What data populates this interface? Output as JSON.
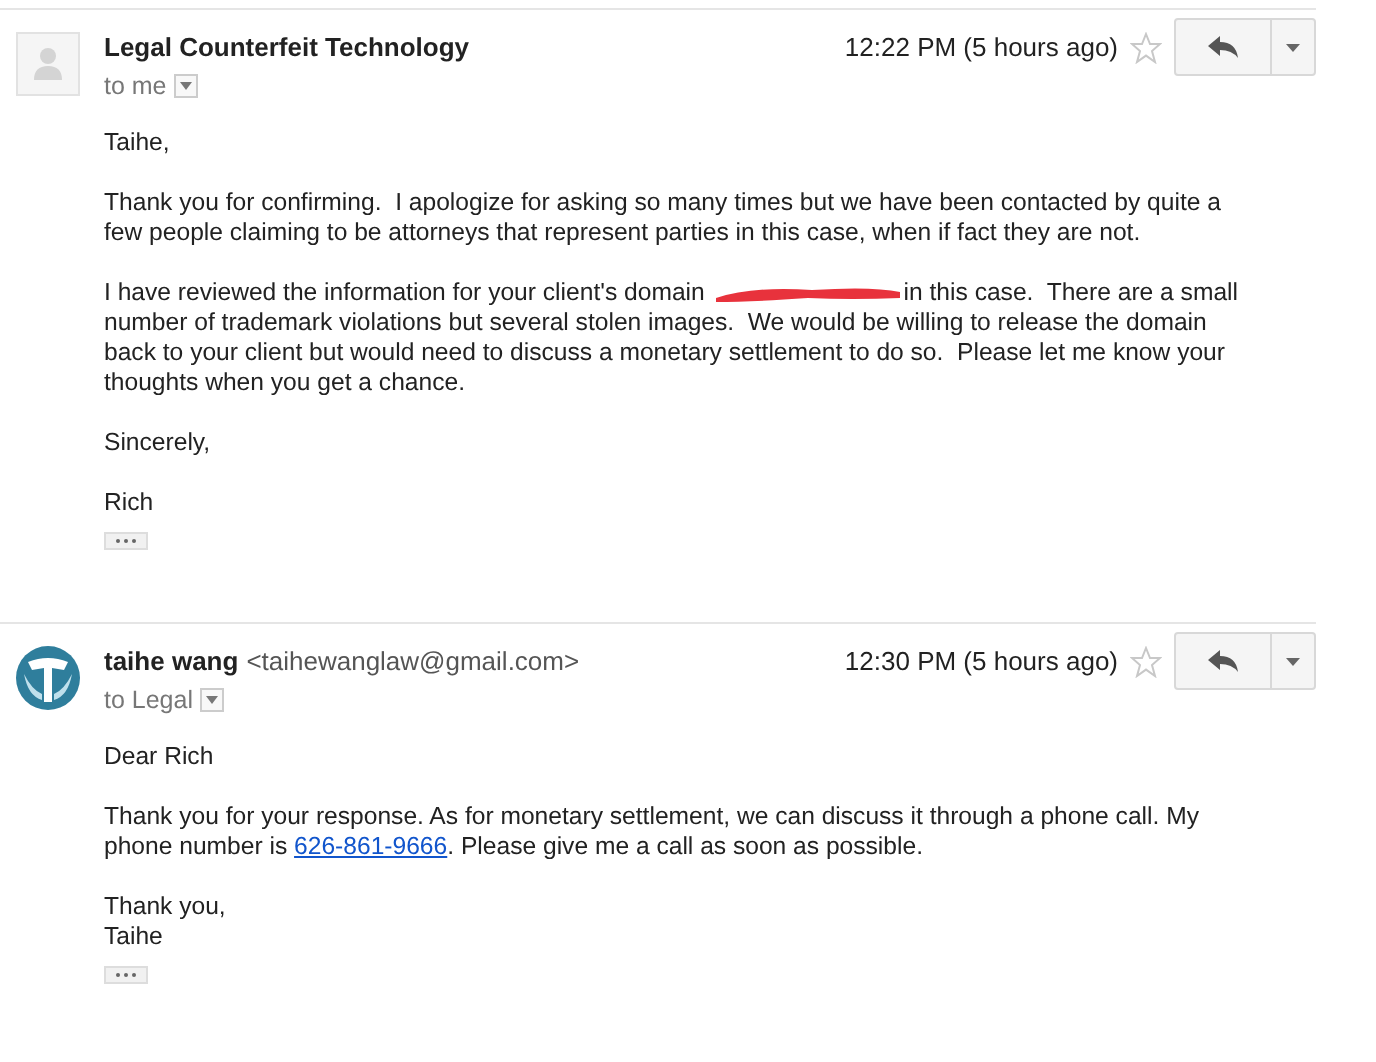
{
  "messages": [
    {
      "avatar": {
        "kind": "placeholder"
      },
      "sender": "Legal Counterfeit Technology",
      "recipient": "to me",
      "time": "12:22 PM (5 hours ago)",
      "starred": false,
      "paragraphs": [
        [
          [
            {
              "kind": "text",
              "text": "Taihe,"
            }
          ]
        ],
        [
          [
            {
              "kind": "text",
              "text": "Thank you for confirming.  I apologize for asking so many times but we have been contacted by quite a"
            }
          ],
          [
            {
              "kind": "text",
              "text": "few people claiming to be attorneys that represent parties in this case, when if fact they are not."
            }
          ]
        ],
        [
          [
            {
              "kind": "text",
              "text": "I have reviewed the information for your client's domain "
            },
            {
              "kind": "redaction"
            },
            {
              "kind": "text",
              "text": "in this case.  There are a small"
            }
          ],
          [
            {
              "kind": "text",
              "text": "number of trademark violations but several stolen images.  We would be willing to release the domain"
            }
          ],
          [
            {
              "kind": "text",
              "text": "back to your client but would need to discuss a monetary settlement to do so.  Please let me know your"
            }
          ],
          [
            {
              "kind": "text",
              "text": "thoughts when you get a chance."
            }
          ]
        ],
        [
          [
            {
              "kind": "text",
              "text": "Sincerely,"
            }
          ]
        ],
        [
          [
            {
              "kind": "text",
              "text": "Rich"
            }
          ]
        ]
      ]
    },
    {
      "avatar": {
        "kind": "logo"
      },
      "sender": "taihe wang",
      "email": "<taihewanglaw@gmail.com>",
      "recipient": "to Legal",
      "time": "12:30 PM (5 hours ago)",
      "starred": false,
      "paragraphs": [
        [
          [
            {
              "kind": "text",
              "text": "Dear Rich"
            }
          ]
        ],
        [
          [
            {
              "kind": "text",
              "text": "Thank you for your response. As for monetary settlement, we can discuss it through a phone call. My"
            }
          ],
          [
            {
              "kind": "text",
              "text": "phone number is "
            },
            {
              "kind": "link",
              "text": "626-861-9666"
            },
            {
              "kind": "text",
              "text": ". Please give me a call as soon as possible."
            }
          ]
        ],
        [
          [
            {
              "kind": "text",
              "text": "Thank you,"
            }
          ],
          [
            {
              "kind": "text",
              "text": "Taihe"
            }
          ]
        ]
      ]
    }
  ]
}
